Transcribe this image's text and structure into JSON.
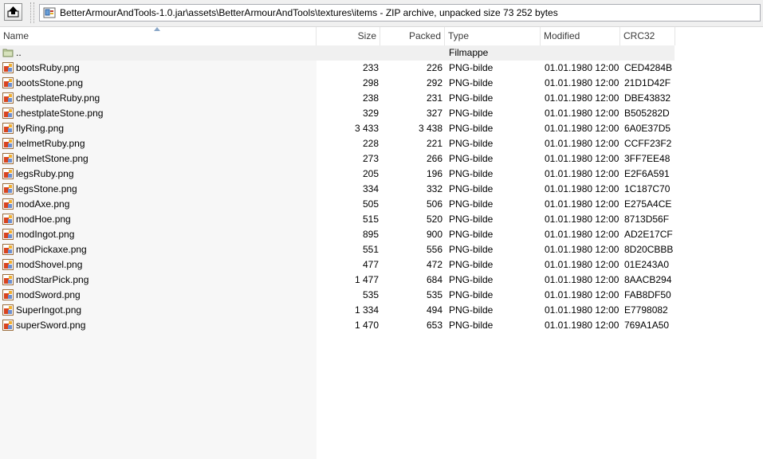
{
  "window": {
    "path": "BetterArmourAndTools-1.0.jar\\assets\\BetterArmourAndTools\\textures\\items - ZIP archive, unpacked size 73 252 bytes"
  },
  "columns": {
    "name": "Name",
    "size": "Size",
    "packed": "Packed",
    "type": "Type",
    "modified": "Modified",
    "crc": "CRC32"
  },
  "parent_row": {
    "name": "..",
    "type": "Filmappe"
  },
  "files": [
    {
      "name": "bootsRuby.png",
      "size": "233",
      "packed": "226",
      "type": "PNG-bilde",
      "modified": "01.01.1980 12:00",
      "crc": "CED4284B"
    },
    {
      "name": "bootsStone.png",
      "size": "298",
      "packed": "292",
      "type": "PNG-bilde",
      "modified": "01.01.1980 12:00",
      "crc": "21D1D42F"
    },
    {
      "name": "chestplateRuby.png",
      "size": "238",
      "packed": "231",
      "type": "PNG-bilde",
      "modified": "01.01.1980 12:00",
      "crc": "DBE43832"
    },
    {
      "name": "chestplateStone.png",
      "size": "329",
      "packed": "327",
      "type": "PNG-bilde",
      "modified": "01.01.1980 12:00",
      "crc": "B505282D"
    },
    {
      "name": "flyRing.png",
      "size": "3 433",
      "packed": "3 438",
      "type": "PNG-bilde",
      "modified": "01.01.1980 12:00",
      "crc": "6A0E37D5"
    },
    {
      "name": "helmetRuby.png",
      "size": "228",
      "packed": "221",
      "type": "PNG-bilde",
      "modified": "01.01.1980 12:00",
      "crc": "CCFF23F2"
    },
    {
      "name": "helmetStone.png",
      "size": "273",
      "packed": "266",
      "type": "PNG-bilde",
      "modified": "01.01.1980 12:00",
      "crc": "3FF7EE48"
    },
    {
      "name": "legsRuby.png",
      "size": "205",
      "packed": "196",
      "type": "PNG-bilde",
      "modified": "01.01.1980 12:00",
      "crc": "E2F6A591"
    },
    {
      "name": "legsStone.png",
      "size": "334",
      "packed": "332",
      "type": "PNG-bilde",
      "modified": "01.01.1980 12:00",
      "crc": "1C187C70"
    },
    {
      "name": "modAxe.png",
      "size": "505",
      "packed": "506",
      "type": "PNG-bilde",
      "modified": "01.01.1980 12:00",
      "crc": "E275A4CE"
    },
    {
      "name": "modHoe.png",
      "size": "515",
      "packed": "520",
      "type": "PNG-bilde",
      "modified": "01.01.1980 12:00",
      "crc": "8713D56F"
    },
    {
      "name": "modIngot.png",
      "size": "895",
      "packed": "900",
      "type": "PNG-bilde",
      "modified": "01.01.1980 12:00",
      "crc": "AD2E17CF"
    },
    {
      "name": "modPickaxe.png",
      "size": "551",
      "packed": "556",
      "type": "PNG-bilde",
      "modified": "01.01.1980 12:00",
      "crc": "8D20CBBB"
    },
    {
      "name": "modShovel.png",
      "size": "477",
      "packed": "472",
      "type": "PNG-bilde",
      "modified": "01.01.1980 12:00",
      "crc": "01E243A0"
    },
    {
      "name": "modStarPick.png",
      "size": "1 477",
      "packed": "684",
      "type": "PNG-bilde",
      "modified": "01.01.1980 12:00",
      "crc": "8AACB294"
    },
    {
      "name": "modSword.png",
      "size": "535",
      "packed": "535",
      "type": "PNG-bilde",
      "modified": "01.01.1980 12:00",
      "crc": "FAB8DF50"
    },
    {
      "name": "SuperIngot.png",
      "size": "1 334",
      "packed": "494",
      "type": "PNG-bilde",
      "modified": "01.01.1980 12:00",
      "crc": "E7798082"
    },
    {
      "name": "superSword.png",
      "size": "1 470",
      "packed": "653",
      "type": "PNG-bilde",
      "modified": "01.01.1980 12:00",
      "crc": "769A1A50"
    }
  ],
  "icons": {
    "up": "up-folder-icon",
    "archive": "zip-archive-icon",
    "folder": "folder-icon",
    "file": "png-file-icon",
    "sort": "sort-ascending-icon"
  }
}
